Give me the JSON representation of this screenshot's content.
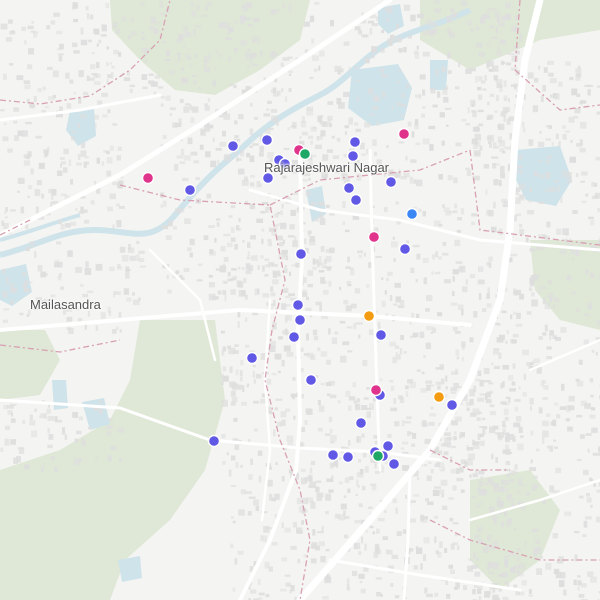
{
  "map": {
    "labels": {
      "rajarajeshwari_nagar": "Rajarajeshwari Nagar",
      "mailasandra": "Mailasandra"
    },
    "colors": {
      "background": "#f4f4f2",
      "park": "#dfe8d6",
      "water": "#cfe3ea",
      "building": "#dedede",
      "road": "#ffffff",
      "boundary": "#d8a0b4"
    }
  },
  "markers": {
    "legend_colors": {
      "purple": "#6159e6",
      "magenta": "#e0338c",
      "green": "#1fa765",
      "orange": "#f39c12",
      "blue": "#3a86f5"
    },
    "points": [
      {
        "category": "purple",
        "lat_rank": 1
      },
      {
        "category": "purple",
        "lat_rank": 2
      },
      {
        "category": "purple",
        "lat_rank": 3
      },
      {
        "category": "purple",
        "lat_rank": 4
      },
      {
        "category": "purple",
        "lat_rank": 5
      },
      {
        "category": "purple",
        "lat_rank": 6
      },
      {
        "category": "purple",
        "lat_rank": 7
      },
      {
        "category": "purple",
        "lat_rank": 8
      },
      {
        "category": "purple",
        "lat_rank": 9
      },
      {
        "category": "purple",
        "lat_rank": 10
      },
      {
        "category": "purple",
        "lat_rank": 11
      },
      {
        "category": "purple",
        "lat_rank": 12
      },
      {
        "category": "purple",
        "lat_rank": 13
      },
      {
        "category": "purple",
        "lat_rank": 14
      },
      {
        "category": "purple",
        "lat_rank": 15
      },
      {
        "category": "purple",
        "lat_rank": 16
      },
      {
        "category": "purple",
        "lat_rank": 17
      },
      {
        "category": "purple",
        "lat_rank": 18
      },
      {
        "category": "purple",
        "lat_rank": 19
      },
      {
        "category": "purple",
        "lat_rank": 20
      },
      {
        "category": "purple",
        "lat_rank": 21
      },
      {
        "category": "purple",
        "lat_rank": 22
      },
      {
        "category": "purple",
        "lat_rank": 23
      },
      {
        "category": "purple",
        "lat_rank": 24
      },
      {
        "category": "purple",
        "lat_rank": 25
      },
      {
        "category": "purple",
        "lat_rank": 26
      },
      {
        "category": "purple",
        "lat_rank": 27
      },
      {
        "category": "purple",
        "lat_rank": 28
      },
      {
        "category": "purple",
        "lat_rank": 29
      },
      {
        "category": "magenta",
        "lat_rank": 30
      },
      {
        "category": "magenta",
        "lat_rank": 31
      },
      {
        "category": "magenta",
        "lat_rank": 32
      },
      {
        "category": "magenta",
        "lat_rank": 33
      },
      {
        "category": "magenta",
        "lat_rank": 34
      },
      {
        "category": "green",
        "lat_rank": 35
      },
      {
        "category": "green",
        "lat_rank": 36
      },
      {
        "category": "orange",
        "lat_rank": 37
      },
      {
        "category": "orange",
        "lat_rank": 38
      },
      {
        "category": "blue",
        "lat_rank": 39
      }
    ]
  }
}
